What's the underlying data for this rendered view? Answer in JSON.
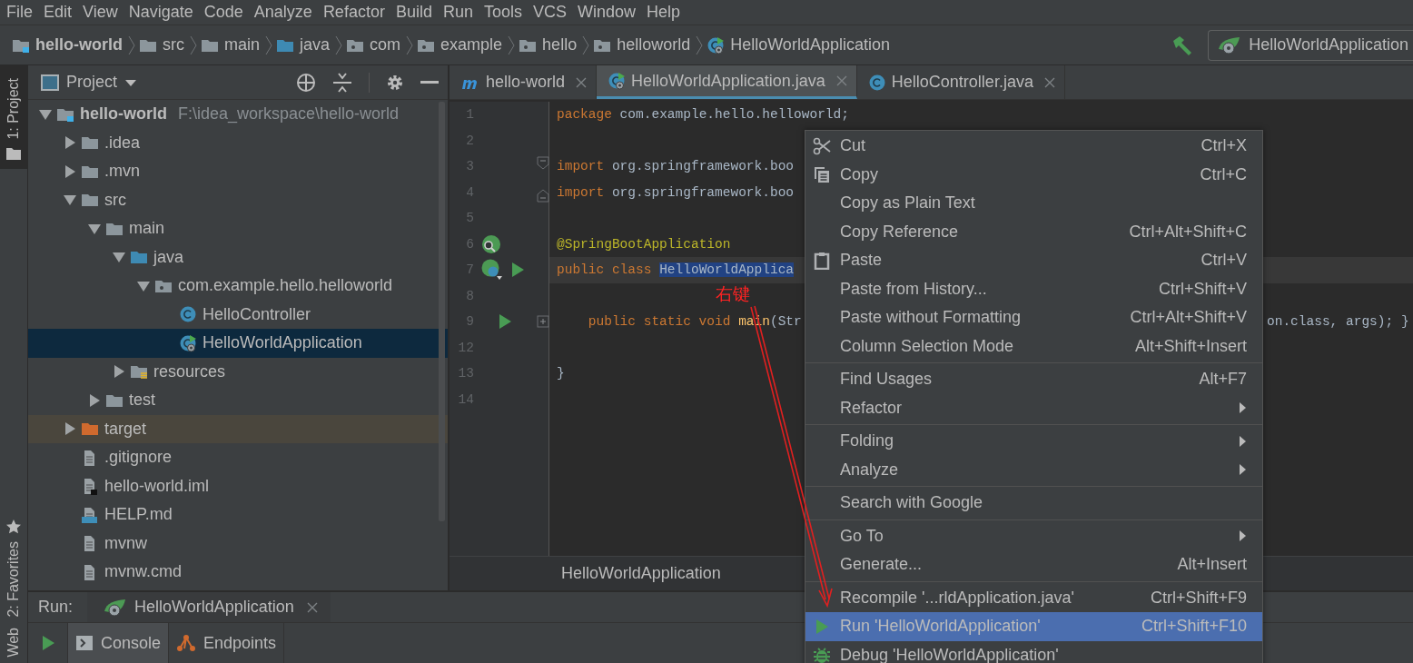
{
  "menu_bar": [
    "File",
    "Edit",
    "View",
    "Navigate",
    "Code",
    "Analyze",
    "Refactor",
    "Build",
    "Run",
    "Tools",
    "VCS",
    "Window",
    "Help"
  ],
  "navigation_bar": {
    "items": [
      {
        "label": "hello-world",
        "kind": "project"
      },
      {
        "label": "src",
        "kind": "folder"
      },
      {
        "label": "main",
        "kind": "folder"
      },
      {
        "label": "java",
        "kind": "source"
      },
      {
        "label": "com",
        "kind": "package"
      },
      {
        "label": "example",
        "kind": "package"
      },
      {
        "label": "hello",
        "kind": "package"
      },
      {
        "label": "helloworld",
        "kind": "package"
      },
      {
        "label": "HelloWorldApplication",
        "kind": "spring-class"
      }
    ],
    "run_configuration": "HelloWorldApplication"
  },
  "tool_strip": {
    "top": [
      {
        "label": "1: Project",
        "selected": true
      }
    ],
    "bottom": [
      {
        "label": "2: Favorites",
        "selected": false
      },
      {
        "label": "Web",
        "selected": false
      }
    ]
  },
  "project_panel": {
    "title": "Project",
    "tree": [
      {
        "label": "hello-world",
        "kind": "project",
        "path": "F:\\idea_workspace\\hello-world",
        "expanded": true,
        "selected": false,
        "excluded": false,
        "children": [
          {
            "label": ".idea",
            "kind": "folder",
            "expanded": false,
            "selected": false,
            "excluded": false
          },
          {
            "label": ".mvn",
            "kind": "folder",
            "expanded": false,
            "selected": false,
            "excluded": false
          },
          {
            "label": "src",
            "kind": "folder",
            "expanded": true,
            "selected": false,
            "excluded": false,
            "children": [
              {
                "label": "main",
                "kind": "folder",
                "expanded": true,
                "selected": false,
                "excluded": false,
                "children": [
                  {
                    "label": "java",
                    "kind": "source",
                    "expanded": true,
                    "selected": false,
                    "excluded": false,
                    "children": [
                      {
                        "label": "com.example.hello.helloworld",
                        "kind": "package",
                        "expanded": true,
                        "selected": false,
                        "excluded": false,
                        "children": [
                          {
                            "label": "HelloController",
                            "kind": "class",
                            "selected": false,
                            "excluded": false
                          },
                          {
                            "label": "HelloWorldApplication",
                            "kind": "spring-class",
                            "selected": true,
                            "excluded": false
                          }
                        ]
                      }
                    ]
                  },
                  {
                    "label": "resources",
                    "kind": "resources",
                    "expanded": false,
                    "selected": false,
                    "excluded": false
                  }
                ]
              },
              {
                "label": "test",
                "kind": "folder",
                "expanded": false,
                "selected": false,
                "excluded": false
              }
            ]
          },
          {
            "label": "target",
            "kind": "folder",
            "expanded": false,
            "selected": false,
            "excluded": true
          },
          {
            "label": ".gitignore",
            "kind": "file",
            "selected": false,
            "excluded": false
          },
          {
            "label": "hello-world.iml",
            "kind": "iml",
            "selected": false,
            "excluded": false
          },
          {
            "label": "HELP.md",
            "kind": "markdown",
            "selected": false,
            "excluded": false
          },
          {
            "label": "mvnw",
            "kind": "file",
            "selected": false,
            "excluded": false
          },
          {
            "label": "mvnw.cmd",
            "kind": "file",
            "selected": false,
            "excluded": false
          }
        ]
      }
    ]
  },
  "editor_tabs": [
    {
      "label": "hello-world",
      "kind": "maven",
      "selected": false
    },
    {
      "label": "HelloWorldApplication.java",
      "kind": "spring-class",
      "selected": true
    },
    {
      "label": "HelloController.java",
      "kind": "class",
      "selected": false
    }
  ],
  "code_lines": [
    {
      "number": "1",
      "current": false,
      "segments": [
        {
          "kind": "keyword",
          "text": "package"
        },
        {
          "kind": "plain",
          "text": " com.example.hello.helloworld;"
        }
      ]
    },
    {
      "number": "2",
      "current": false
    },
    {
      "number": "3",
      "current": false,
      "markers": [
        {
          "kind": "fold-start"
        }
      ],
      "segments": [
        {
          "kind": "keyword",
          "text": "import"
        },
        {
          "kind": "plain",
          "text": " org.springframework.boo"
        }
      ]
    },
    {
      "number": "4",
      "current": false,
      "markers": [
        {
          "kind": "fold-end"
        }
      ],
      "segments": [
        {
          "kind": "keyword",
          "text": "import"
        },
        {
          "kind": "plain",
          "text": " org.springframework.boo"
        }
      ]
    },
    {
      "number": "5",
      "current": false
    },
    {
      "number": "6",
      "current": false,
      "markers": [
        {
          "kind": "bean-search"
        }
      ],
      "segments": [
        {
          "kind": "annotation",
          "text": "@SpringBootApplication"
        }
      ]
    },
    {
      "number": "7",
      "current": true,
      "markers": [
        {
          "kind": "bean-class"
        },
        {
          "kind": "run"
        }
      ],
      "segments": [
        {
          "kind": "keyword",
          "text": "public class "
        },
        {
          "kind": "selected",
          "text": "HelloWorldApplica"
        }
      ]
    },
    {
      "number": "8",
      "current": false
    },
    {
      "number": "9",
      "current": false,
      "indented": true,
      "markers": [
        {
          "kind": "run"
        },
        {
          "kind": "fold-collapsed"
        }
      ],
      "segments": [
        {
          "kind": "keyword",
          "text": "public static void "
        },
        {
          "kind": "method",
          "text": "main"
        },
        {
          "kind": "plain",
          "text": "(Str"
        }
      ],
      "tail": [
        {
          "kind": "plain",
          "text": "on.class, args); }"
        }
      ]
    },
    {
      "number": "12",
      "current": false
    },
    {
      "number": "13",
      "current": false,
      "segments": [
        {
          "kind": "plain",
          "text": "}"
        }
      ]
    },
    {
      "number": "14",
      "current": false
    }
  ],
  "editor_breadcrumb": "HelloWorldApplication",
  "run_panel": {
    "label": "Run:",
    "tab": "HelloWorldApplication",
    "tabs": [
      {
        "label": "Console",
        "kind": "console",
        "selected": true
      },
      {
        "label": "Endpoints",
        "kind": "endpoints",
        "selected": false
      }
    ]
  },
  "context_menu": {
    "items": [
      {
        "kind": "cut",
        "label": "Cut",
        "shortcut": "Ctrl+X",
        "selected": false
      },
      {
        "kind": "copy",
        "label": "Copy",
        "shortcut": "Ctrl+C",
        "selected": false
      },
      {
        "kind": "action",
        "label": "Copy as Plain Text",
        "selected": false
      },
      {
        "kind": "action",
        "label": "Copy Reference",
        "shortcut": "Ctrl+Alt+Shift+C",
        "selected": false
      },
      {
        "kind": "paste",
        "label": "Paste",
        "shortcut": "Ctrl+V",
        "selected": false
      },
      {
        "kind": "action",
        "label": "Paste from History...",
        "shortcut": "Ctrl+Shift+V",
        "selected": false
      },
      {
        "kind": "action",
        "label": "Paste without Formatting",
        "shortcut": "Ctrl+Alt+Shift+V",
        "selected": false
      },
      {
        "kind": "action",
        "label": "Column Selection Mode",
        "shortcut": "Alt+Shift+Insert",
        "selected": false
      },
      {
        "kind": "separator"
      },
      {
        "kind": "action",
        "label": "Find Usages",
        "shortcut": "Alt+F7",
        "selected": false
      },
      {
        "kind": "action",
        "label": "Refactor",
        "submenu": true,
        "selected": false
      },
      {
        "kind": "separator"
      },
      {
        "kind": "action",
        "label": "Folding",
        "submenu": true,
        "selected": false
      },
      {
        "kind": "action",
        "label": "Analyze",
        "submenu": true,
        "selected": false
      },
      {
        "kind": "separator"
      },
      {
        "kind": "action",
        "label": "Search with Google",
        "selected": false
      },
      {
        "kind": "separator"
      },
      {
        "kind": "action",
        "label": "Go To",
        "submenu": true,
        "selected": false
      },
      {
        "kind": "action",
        "label": "Generate...",
        "shortcut": "Alt+Insert",
        "selected": false
      },
      {
        "kind": "separator"
      },
      {
        "kind": "action",
        "label": "Recompile '...rldApplication.java'",
        "shortcut": "Ctrl+Shift+F9",
        "selected": false
      },
      {
        "kind": "run",
        "label": "Run 'HelloWorldApplication'",
        "shortcut": "Ctrl+Shift+F10",
        "selected": true
      },
      {
        "kind": "debug",
        "label": "Debug 'HelloWorldApplication'",
        "selected": false
      }
    ]
  },
  "annotation": {
    "text": "右键"
  }
}
